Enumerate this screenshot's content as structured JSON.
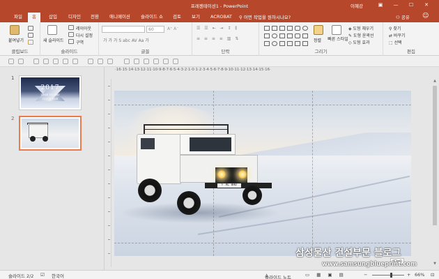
{
  "window": {
    "title": "프레젠테이션1 - PowerPoint",
    "user": "이혜강",
    "controls": [
      "▣",
      "—",
      "☐",
      "✕"
    ]
  },
  "tabs": {
    "file": "파일",
    "home": "홈",
    "items": [
      "삽입",
      "디자인",
      "전환",
      "애니메이션",
      "슬라이드 쇼",
      "검토",
      "보기",
      "ACROBAT"
    ],
    "tell_me": "어떤 작업을 원하시나요?",
    "share": "공유"
  },
  "ribbon": {
    "clipboard": {
      "paste": "붙여넣기",
      "label": "클립보드"
    },
    "slides": {
      "new_slide": "새 슬라이드",
      "layout": "레이아웃",
      "reset": "다시 설정",
      "section": "구역",
      "label": "슬라이드"
    },
    "font": {
      "size_value": "60",
      "label": "글꼴",
      "buttons": [
        "가",
        "가",
        "가",
        "S",
        "abc",
        "AV",
        "Aa",
        "가"
      ]
    },
    "paragraph": {
      "label": "단락"
    },
    "drawing": {
      "arrange": "정렬",
      "quick_styles": "빠른 스타일",
      "fill": "도형 채우기",
      "outline": "도형 윤곽선",
      "effects": "도형 효과",
      "label": "그리기"
    },
    "editing": {
      "find": "찾기",
      "replace": "바꾸기",
      "select": "선택",
      "label": "편집"
    }
  },
  "ruler": {
    "horizontal": "·16·15·14·13·12·11·10·9·8·7·6·5·4·3·2·1·0·1·2·3·4·5·6·7·8·9·10·11·12·13·14·15·16·"
  },
  "thumbnails": [
    {
      "number": "1",
      "line1": "2017",
      "line2": "TIME TO SAY",
      "line3": "GOOD BYE",
      "selected": false
    },
    {
      "number": "2",
      "selected": true
    }
  ],
  "slide": {
    "plate": "F AL 8HD"
  },
  "watermark": {
    "title": "삼성물산 건설부문 블로그",
    "url": "www.samsungblueprint.com"
  },
  "ctrl_tag": "(Ctrl)",
  "status": {
    "slide_count": "슬라이드 2/2",
    "language": "한국어",
    "notes": "슬라이드 노트",
    "zoom": "66%",
    "zoom_fraction": 0.66
  },
  "colors": {
    "accent": "#b7472a",
    "selected_thumb": "#e97b4f"
  },
  "icons": [
    "paste-icon",
    "new-slide-icon",
    "arrange-icon",
    "quick-styles-icon",
    "find-icon",
    "search-icon",
    "share-icon",
    "smile-icon",
    "notes-icon",
    "zoom-slider-icon"
  ]
}
